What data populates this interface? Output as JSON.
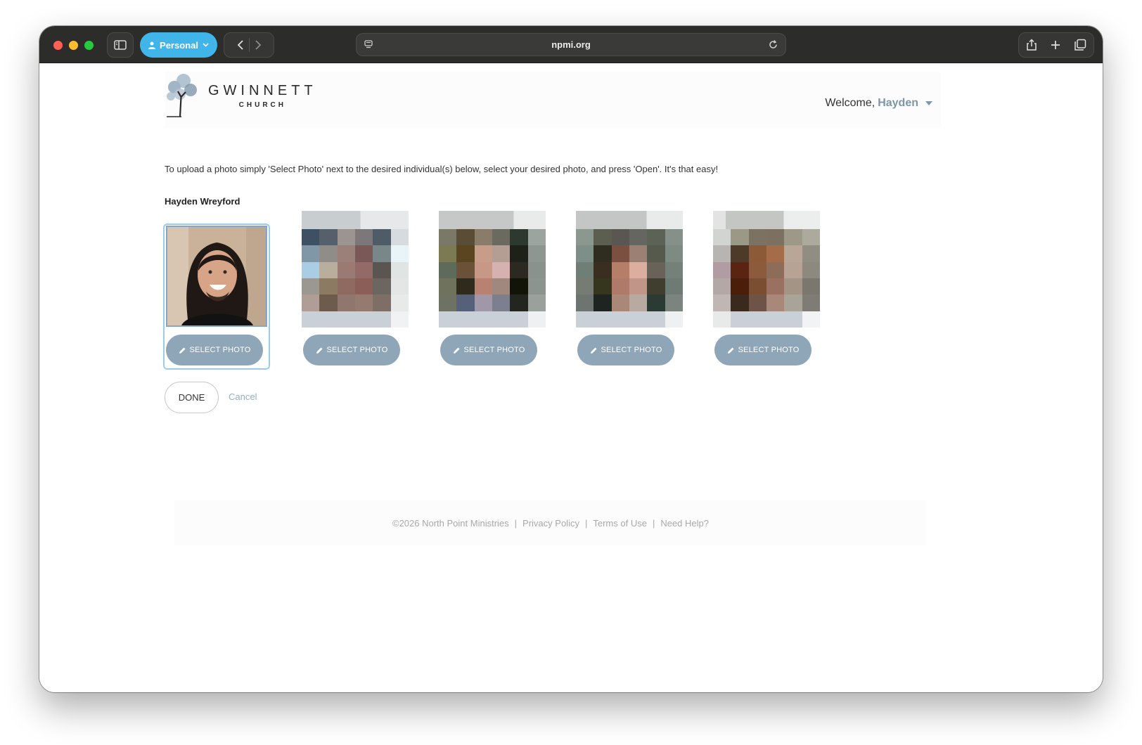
{
  "browser": {
    "profile_label": "Personal",
    "url": "npmi.org"
  },
  "header": {
    "logo_title": "GWINNETT",
    "logo_subtitle": "CHURCH",
    "welcome_prefix": "Welcome,",
    "welcome_user": "Hayden"
  },
  "instructions": "To upload a photo simply 'Select Photo' next to the desired individual(s) below, select your desired photo, and press 'Open'. It's that easy!",
  "people": [
    {
      "name": "Hayden Wreyford",
      "button": "SELECT PHOTO"
    },
    {
      "name": "",
      "button": "SELECT PHOTO"
    },
    {
      "name": "",
      "button": "SELECT PHOTO"
    },
    {
      "name": "",
      "button": "SELECT PHOTO"
    },
    {
      "name": "",
      "button": "SELECT PHOTO"
    }
  ],
  "actions": {
    "done_label": "DONE",
    "cancel_label": "Cancel"
  },
  "footer": {
    "copyright": "©2026 North Point Ministries",
    "privacy": "Privacy Policy",
    "terms": "Terms of Use",
    "help": "Need Help?"
  },
  "colors": {
    "accent_button": "#8ea6b8",
    "profile_pill": "#3fb5ea",
    "selected_border": "#9ccbe8"
  }
}
